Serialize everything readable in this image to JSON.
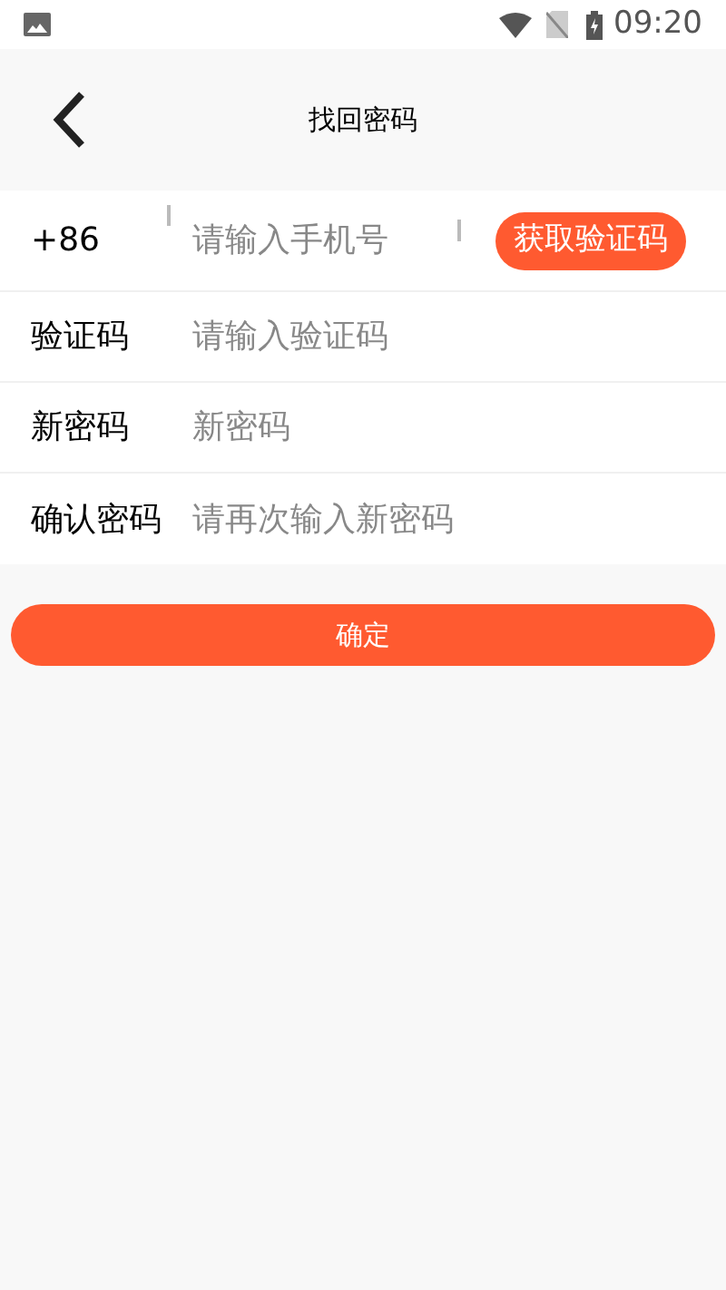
{
  "status_bar": {
    "time": "09:20"
  },
  "header": {
    "title": "找回密码"
  },
  "phone_row": {
    "prefix": "+86",
    "placeholder": "请输入手机号",
    "button": "获取验证码"
  },
  "fields": [
    {
      "label": "验证码",
      "placeholder": "请输入验证码"
    },
    {
      "label": "新密码",
      "placeholder": "新密码"
    },
    {
      "label": "确认密码",
      "placeholder": "请再次输入新密码"
    }
  ],
  "submit": "确定"
}
